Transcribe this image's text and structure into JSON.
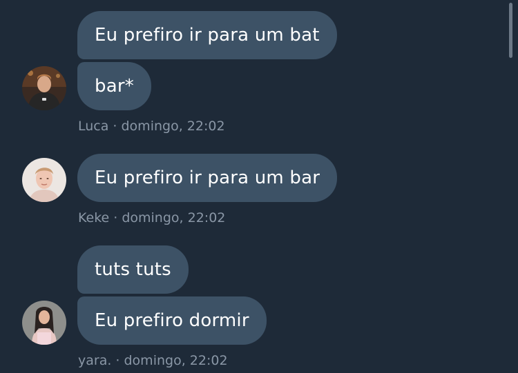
{
  "groups": [
    {
      "author": "Luca",
      "messages": [
        "Eu prefiro ir para um bat",
        "bar*"
      ],
      "meta": "Luca · domingo, 22:02",
      "avatar_icon": "user-avatar-luca"
    },
    {
      "author": "Keke",
      "messages": [
        "Eu prefiro ir para um bar"
      ],
      "meta": "Keke · domingo, 22:02",
      "avatar_icon": "user-avatar-keke"
    },
    {
      "author": "yara.",
      "messages": [
        "tuts tuts",
        "Eu prefiro dormir"
      ],
      "meta": "yara. · domingo, 22:02",
      "avatar_icon": "user-avatar-yara"
    }
  ],
  "colors": {
    "background": "#1e2a38",
    "bubble": "#3d5266",
    "meta_text": "#8a97a6",
    "message_text": "#ffffff"
  }
}
